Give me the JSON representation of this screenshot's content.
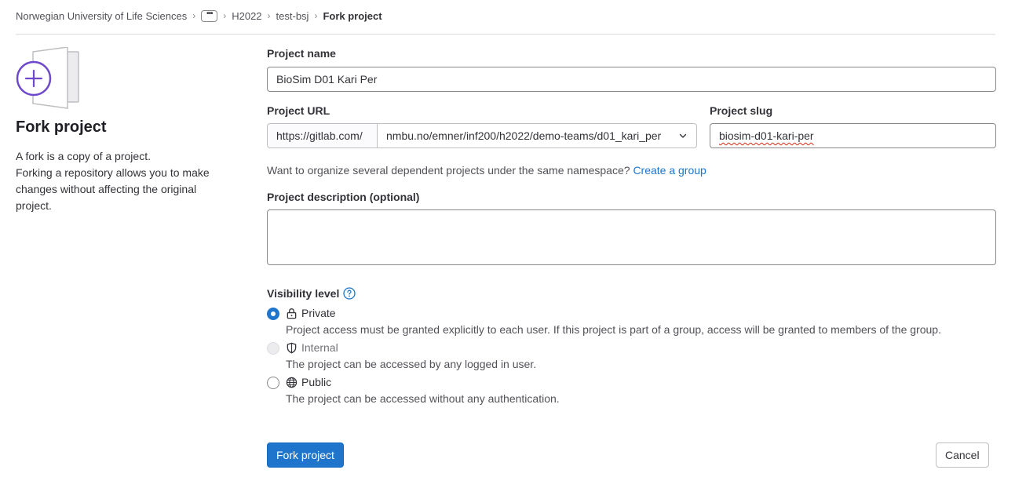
{
  "breadcrumb": {
    "items": [
      "Norwegian University of Life Sciences",
      "H2022",
      "test-bsj"
    ],
    "more": "•••",
    "current": "Fork project"
  },
  "sidebar": {
    "title": "Fork project",
    "description": "A fork is a copy of a project.\nForking a repository allows you to make changes without affecting the original project."
  },
  "form": {
    "project_name_label": "Project name",
    "project_name_value": "BioSim D01 Kari Per",
    "project_url_label": "Project URL",
    "url_prefix": "https://gitlab.com/",
    "namespace_value": "nmbu.no/emner/inf200/h2022/demo-teams/d01_kari_per",
    "project_slug_label": "Project slug",
    "project_slug_value": "biosim-d01-kari-per",
    "group_help": "Want to organize several dependent projects under the same namespace?",
    "group_link": "Create a group",
    "description_label": "Project description (optional)",
    "description_value": "",
    "visibility_label": "Visibility level",
    "visibility": {
      "selected": "Private",
      "options": [
        {
          "title": "Private",
          "icon": "lock-icon",
          "desc": "Project access must be granted explicitly to each user. If this project is part of a group, access will be granted to members of the group.",
          "disabled": false
        },
        {
          "title": "Internal",
          "icon": "shield-icon",
          "desc": "The project can be accessed by any logged in user.",
          "disabled": true
        },
        {
          "title": "Public",
          "icon": "globe-icon",
          "desc": "The project can be accessed without any authentication.",
          "disabled": false
        }
      ]
    }
  },
  "actions": {
    "submit": "Fork project",
    "cancel": "Cancel"
  },
  "colors": {
    "accent": "#1f75cb",
    "illustration_purple": "#6e49cb"
  }
}
